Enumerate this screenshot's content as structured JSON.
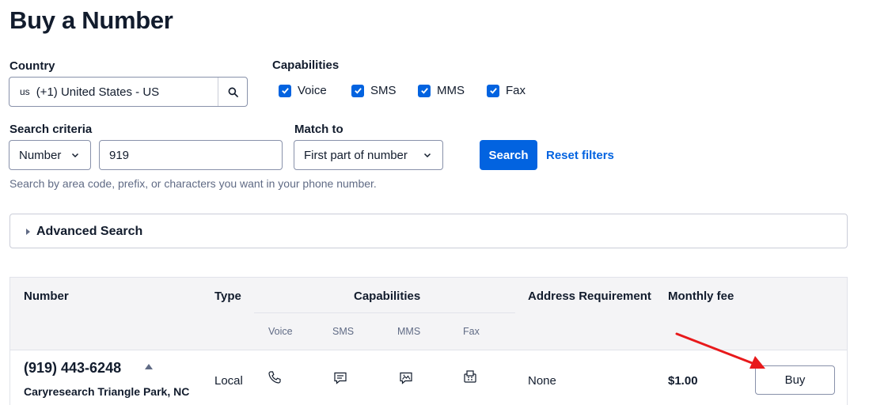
{
  "page": {
    "title": "Buy a Number"
  },
  "country": {
    "label": "Country",
    "flag_code": "us",
    "value": "(+1) United States - US",
    "search_icon": "search-icon"
  },
  "capabilities": {
    "label": "Capabilities",
    "items": [
      {
        "label": "Voice",
        "checked": true
      },
      {
        "label": "SMS",
        "checked": true
      },
      {
        "label": "MMS",
        "checked": true
      },
      {
        "label": "Fax",
        "checked": true
      }
    ]
  },
  "search_criteria": {
    "label": "Search criteria",
    "type_value": "Number",
    "value": "919",
    "help": "Search by area code, prefix, or characters you want in your phone number."
  },
  "match_to": {
    "label": "Match to",
    "value": "First part of number"
  },
  "actions": {
    "search_label": "Search",
    "reset_label": "Reset filters"
  },
  "advanced": {
    "label": "Advanced Search"
  },
  "table": {
    "headers": {
      "number": "Number",
      "type": "Type",
      "capabilities": "Capabilities",
      "address": "Address Requirement",
      "fee": "Monthly fee"
    },
    "sub_headers": [
      "Voice",
      "SMS",
      "MMS",
      "Fax"
    ],
    "rows": [
      {
        "number": "(919) 443-6248",
        "location": "Caryresearch Triangle Park, NC",
        "type": "Local",
        "address": "None",
        "fee": "$1.00",
        "buy_label": "Buy"
      }
    ]
  },
  "colors": {
    "primary": "#0263e0",
    "annotation_arrow": "#e8191b"
  }
}
